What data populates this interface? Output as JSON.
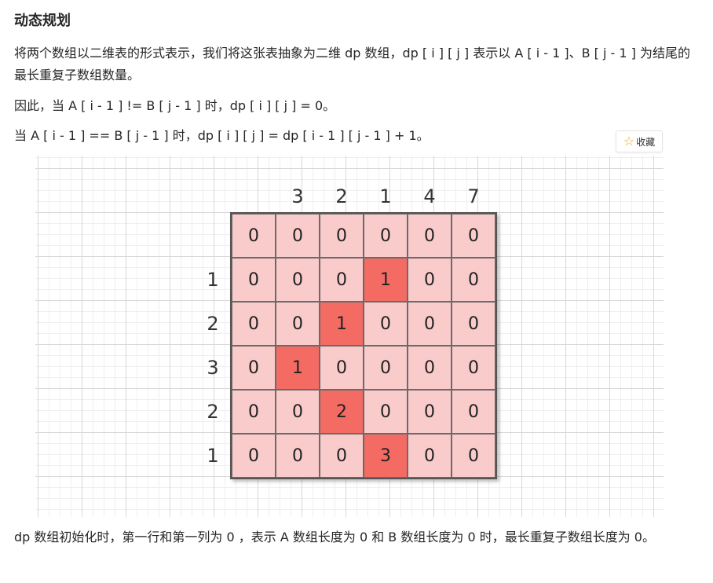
{
  "title": "动态规划",
  "paragraphs": [
    "将两个数组以二维表的形式表示，我们将这张表抽象为二维 dp 数组，dp [ i ] [ j ] 表示以 A [ i - 1 ]、B [ j - 1 ] 为结尾的最长重复子数组数量。",
    "因此，当 A [ i - 1 ] != B [ j - 1 ] 时，dp [ i ] [ j ] = 0。",
    "当 A [ i - 1 ] == B [ j - 1 ] 时，dp [ i ] [ j ] = dp [ i - 1 ] [ j - 1 ] + 1。",
    "dp 数组初始化时，第一行和第一列为 0 ，表示 A 数组长度为 0 和 B 数组长度为 0 时，最长重复子数组长度为 0。"
  ],
  "favorite_button": {
    "icon": "star-icon",
    "label": "收藏"
  },
  "figure": {
    "top_labels": [
      "3",
      "2",
      "1",
      "4",
      "7"
    ],
    "left_labels": [
      "1",
      "2",
      "3",
      "2",
      "1"
    ],
    "matrix": [
      [
        "0",
        "0",
        "0",
        "0",
        "0",
        "0"
      ],
      [
        "0",
        "0",
        "0",
        "1",
        "0",
        "0"
      ],
      [
        "0",
        "0",
        "1",
        "0",
        "0",
        "0"
      ],
      [
        "0",
        "1",
        "0",
        "0",
        "0",
        "0"
      ],
      [
        "0",
        "0",
        "2",
        "0",
        "0",
        "0"
      ],
      [
        "0",
        "0",
        "0",
        "3",
        "0",
        "0"
      ]
    ],
    "highlighted": [
      [
        1,
        3
      ],
      [
        2,
        2
      ],
      [
        3,
        1
      ],
      [
        4,
        2
      ],
      [
        5,
        3
      ]
    ],
    "colors": {
      "cell": "#f9cbcb",
      "highlight": "#f36b63",
      "border": "#555555"
    }
  }
}
